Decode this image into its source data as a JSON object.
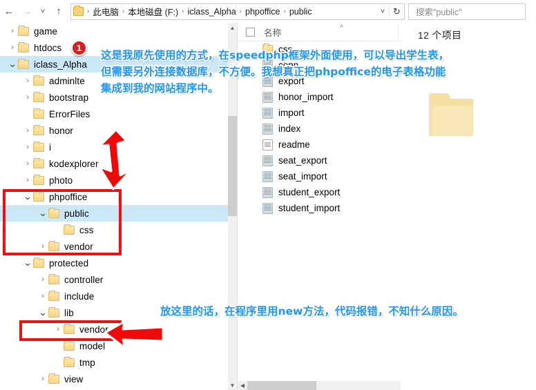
{
  "window": {
    "nav": {
      "back_icon": "arrow-left-icon",
      "forward_icon": "arrow-right-icon",
      "recent_icon": "chevron-down-icon",
      "up_icon": "arrow-up-icon"
    },
    "address": {
      "folder_icon": "folder-icon",
      "crumbs": [
        "此电脑",
        "本地磁盘 (F:)",
        "iclass_Alpha",
        "phpoffice",
        "public"
      ],
      "separator": "›",
      "dropdown_icon": "chevron-down-icon",
      "refresh_icon": "refresh-icon"
    },
    "search": {
      "placeholder": "搜索\"public\"",
      "value": "搜索\"public\""
    }
  },
  "tree": {
    "items": [
      {
        "label": "game",
        "indent": 0,
        "state": "collapsed",
        "selected": false
      },
      {
        "label": "htdocs",
        "indent": 0,
        "state": "collapsed",
        "selected": false
      },
      {
        "label": "iclass_Alpha",
        "indent": 0,
        "state": "expanded",
        "selected": true
      },
      {
        "label": "adminlte",
        "indent": 1,
        "state": "collapsed",
        "selected": false
      },
      {
        "label": "bootstrap",
        "indent": 1,
        "state": "collapsed",
        "selected": false
      },
      {
        "label": "ErrorFiles",
        "indent": 1,
        "state": "leaf",
        "selected": false
      },
      {
        "label": "honor",
        "indent": 1,
        "state": "collapsed",
        "selected": false
      },
      {
        "label": "i",
        "indent": 1,
        "state": "collapsed",
        "selected": false
      },
      {
        "label": "kodexplorer",
        "indent": 1,
        "state": "collapsed",
        "selected": false
      },
      {
        "label": "photo",
        "indent": 1,
        "state": "collapsed",
        "selected": false
      },
      {
        "label": "phpoffice",
        "indent": 1,
        "state": "expanded",
        "selected": false
      },
      {
        "label": "public",
        "indent": 2,
        "state": "expanded",
        "selected": true
      },
      {
        "label": "css",
        "indent": 3,
        "state": "leaf",
        "selected": false
      },
      {
        "label": "vendor",
        "indent": 2,
        "state": "collapsed",
        "selected": false
      },
      {
        "label": "protected",
        "indent": 1,
        "state": "expanded",
        "selected": false
      },
      {
        "label": "controller",
        "indent": 2,
        "state": "collapsed",
        "selected": false
      },
      {
        "label": "include",
        "indent": 2,
        "state": "collapsed",
        "selected": false
      },
      {
        "label": "lib",
        "indent": 2,
        "state": "expanded",
        "selected": false
      },
      {
        "label": "vendor",
        "indent": 3,
        "state": "collapsed",
        "selected": false
      },
      {
        "label": "model",
        "indent": 3,
        "state": "leaf",
        "selected": false
      },
      {
        "label": "tmp",
        "indent": 3,
        "state": "leaf",
        "selected": false
      },
      {
        "label": "view",
        "indent": 2,
        "state": "collapsed",
        "selected": false
      }
    ]
  },
  "list": {
    "header": {
      "checkbox_icon": "checkbox-icon",
      "name_column": "名称",
      "sort_caret": "^"
    },
    "rows": [
      {
        "label": "css",
        "icon": "folder-icon"
      },
      {
        "label": "conn",
        "icon": "php-file-icon"
      },
      {
        "label": "export",
        "icon": "php-file-icon"
      },
      {
        "label": "honor_import",
        "icon": "php-file-icon"
      },
      {
        "label": "import",
        "icon": "php-file-icon"
      },
      {
        "label": "index",
        "icon": "php-file-icon"
      },
      {
        "label": "readme",
        "icon": "text-file-icon"
      },
      {
        "label": "seat_export",
        "icon": "php-file-icon"
      },
      {
        "label": "seat_import",
        "icon": "php-file-icon"
      },
      {
        "label": "student_export",
        "icon": "php-file-icon"
      },
      {
        "label": "student_import",
        "icon": "php-file-icon"
      }
    ]
  },
  "preview": {
    "item_count": "12 个项目",
    "folder_icon": "large-folder-icon"
  },
  "annotations": {
    "badge_one": "1",
    "top_text_lines": [
      "这是我原先使用的方式，在speedphp框架外面使用，可以导出学生表，",
      "但需要另外连接数据库，不方便。我想真正把phpoffice的电子表格功能",
      "集成到我的网站程序中。"
    ],
    "bottom_text": "放这里的话，在程序里用new方法，代码报错，不知什么原因。",
    "arrow_down_icon": "red-arrow-down-icon",
    "arrow_left_icon": "red-arrow-left-icon",
    "highlight_box_1": "phpoffice-public-vendor-box",
    "highlight_box_2": "lib-vendor-box",
    "accent_color": "#2196f3",
    "marker_color": "#ef1111"
  }
}
